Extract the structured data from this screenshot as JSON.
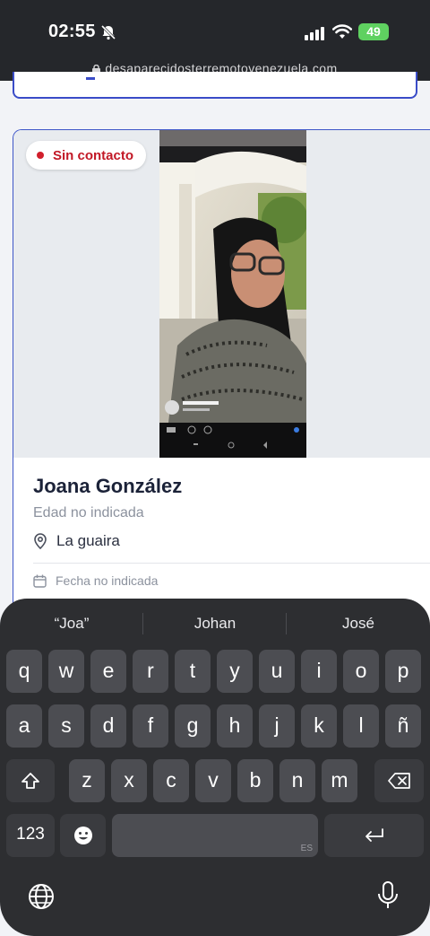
{
  "status_bar": {
    "time": "02:55",
    "battery": "49"
  },
  "browser": {
    "url": "desaparecidosterremotovenezuela.com"
  },
  "card": {
    "badge": "Sin contacto",
    "name": "Joana González",
    "age": "Edad no indicada",
    "location": "La guaira",
    "date": "Fecha no indicada"
  },
  "keyboard": {
    "suggestions": [
      "“Joa”",
      "Johan",
      "José"
    ],
    "row1": [
      "q",
      "w",
      "e",
      "r",
      "t",
      "y",
      "u",
      "i",
      "o",
      "p"
    ],
    "row2": [
      "a",
      "s",
      "d",
      "f",
      "g",
      "h",
      "j",
      "k",
      "l",
      "ñ"
    ],
    "row3": [
      "z",
      "x",
      "c",
      "v",
      "b",
      "n",
      "m"
    ],
    "numbers_label": "123",
    "space_label": "ES"
  },
  "colors": {
    "accent": "#3e56c8",
    "badge_red": "#c21826",
    "keyboard_bg": "#2d2e31",
    "key_bg": "#4c4d52"
  },
  "icons": [
    "bell-slash-icon",
    "signal-icon",
    "wifi-icon",
    "lock-icon",
    "location-pin-icon",
    "calendar-icon",
    "shift-icon",
    "backspace-icon",
    "emoji-icon",
    "return-icon",
    "globe-icon",
    "microphone-icon"
  ]
}
